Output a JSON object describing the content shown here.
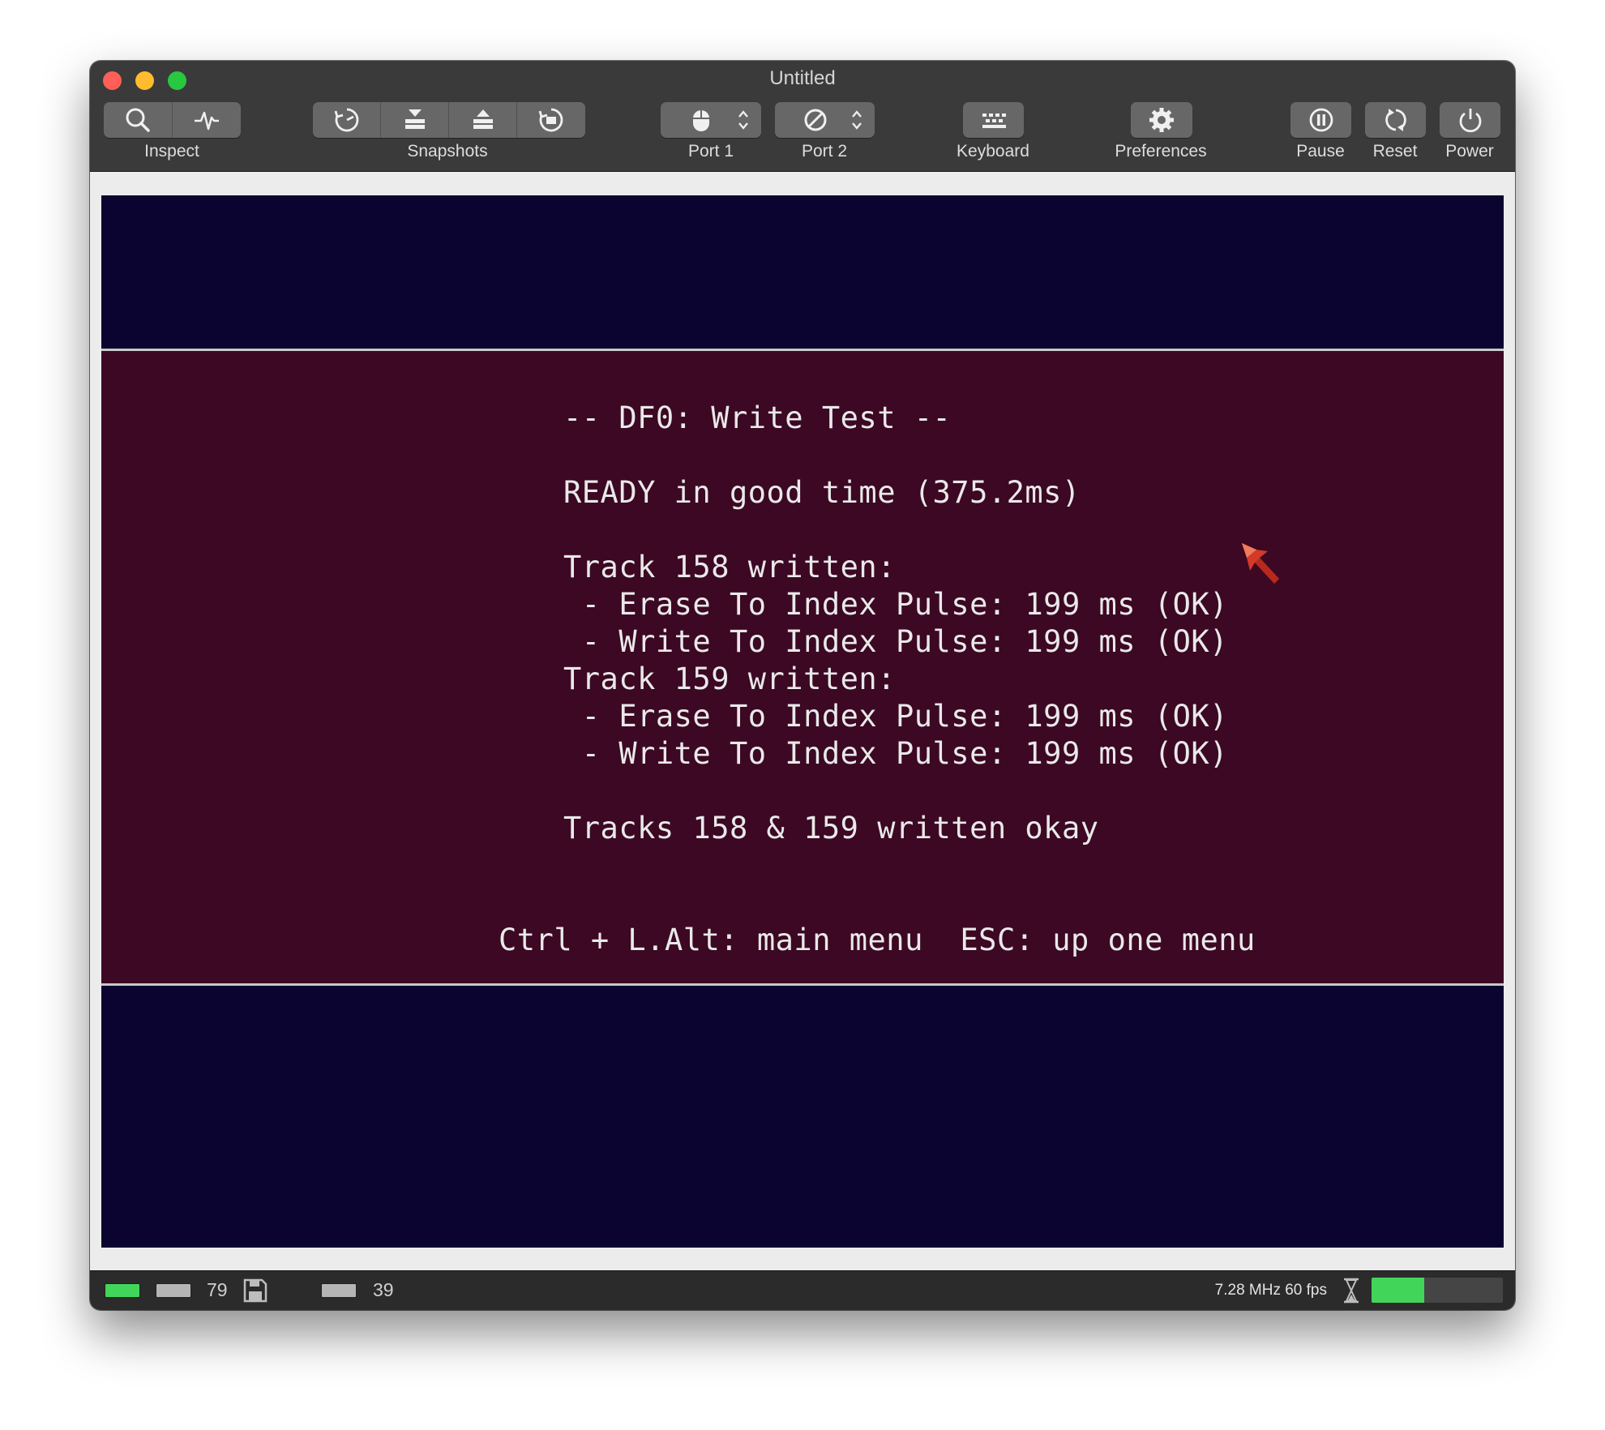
{
  "window": {
    "title": "Untitled"
  },
  "toolbar": {
    "inspect": {
      "label": "Inspect",
      "icons": [
        "magnifier-icon",
        "pulse-icon"
      ]
    },
    "snapshots": {
      "label": "Snapshots",
      "icons": [
        "snapshot-timer-icon",
        "take-snapshot-icon",
        "restore-snapshot-icon",
        "snapshot-browser-icon"
      ]
    },
    "port1": {
      "label": "Port 1",
      "icon": "mouse-icon"
    },
    "port2": {
      "label": "Port 2",
      "icon": "none-icon"
    },
    "keyboard": {
      "label": "Keyboard",
      "icon": "keyboard-icon"
    },
    "preferences": {
      "label": "Preferences",
      "icon": "gear-icon"
    },
    "pause": {
      "label": "Pause",
      "icon": "pause-icon"
    },
    "reset": {
      "label": "Reset",
      "icon": "reset-icon"
    },
    "power": {
      "label": "Power",
      "icon": "power-icon"
    }
  },
  "screen": {
    "colors": {
      "border_bg": "#0b0430",
      "content_bg": "#3c0823",
      "text": "#e9e9e9",
      "divider": "#c9c9c9"
    },
    "lines": {
      "heading": "-- DF0: Write Test --",
      "ready": "READY in good time (375.2ms)",
      "track1_header": "Track 158 written:",
      "track1_erase": " - Erase To Index Pulse: 199 ms (OK)",
      "track1_write": " - Write To Index Pulse: 199 ms (OK)",
      "track2_header": "Track 159 written:",
      "track2_erase": " - Erase To Index Pulse: 199 ms (OK)",
      "track2_write": " - Write To Index Pulse: 199 ms (OK)",
      "summary": "Tracks 158 & 159 written okay",
      "footer": "Ctrl + L.Alt: main menu  ESC: up one menu"
    }
  },
  "statusbar": {
    "df0_cylinder": "79",
    "df1_cylinder": "39",
    "speed": "7.28 MHz 60 fps",
    "speed_fraction": 0.4,
    "colors": {
      "led_green": "#41d65a",
      "led_off": "#b5b5b5"
    }
  }
}
